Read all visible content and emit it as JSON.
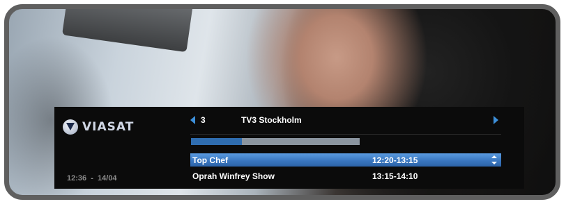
{
  "brand": {
    "name": "VIASAT",
    "mark_color": "#1a2848",
    "text_color": "#cfd6e4"
  },
  "clock": {
    "time": "12:36",
    "separator": "-",
    "date": "14/04",
    "display": "12:36  -  14/04"
  },
  "channel": {
    "number": "3",
    "name": "TV3 Stockholm"
  },
  "progress": {
    "fraction": 0.3,
    "accent": "#2f6db0"
  },
  "programs": [
    {
      "title": "Top Chef",
      "time": "12:20-13:15",
      "selected": true
    },
    {
      "title": "Oprah Winfrey Show",
      "time": "13:15-14:10",
      "selected": false
    }
  ],
  "colors": {
    "accent": "#3d8fd9",
    "selection": "#3a77c0",
    "panel": "#0b0b0b",
    "frame": "#5f5f5f"
  }
}
